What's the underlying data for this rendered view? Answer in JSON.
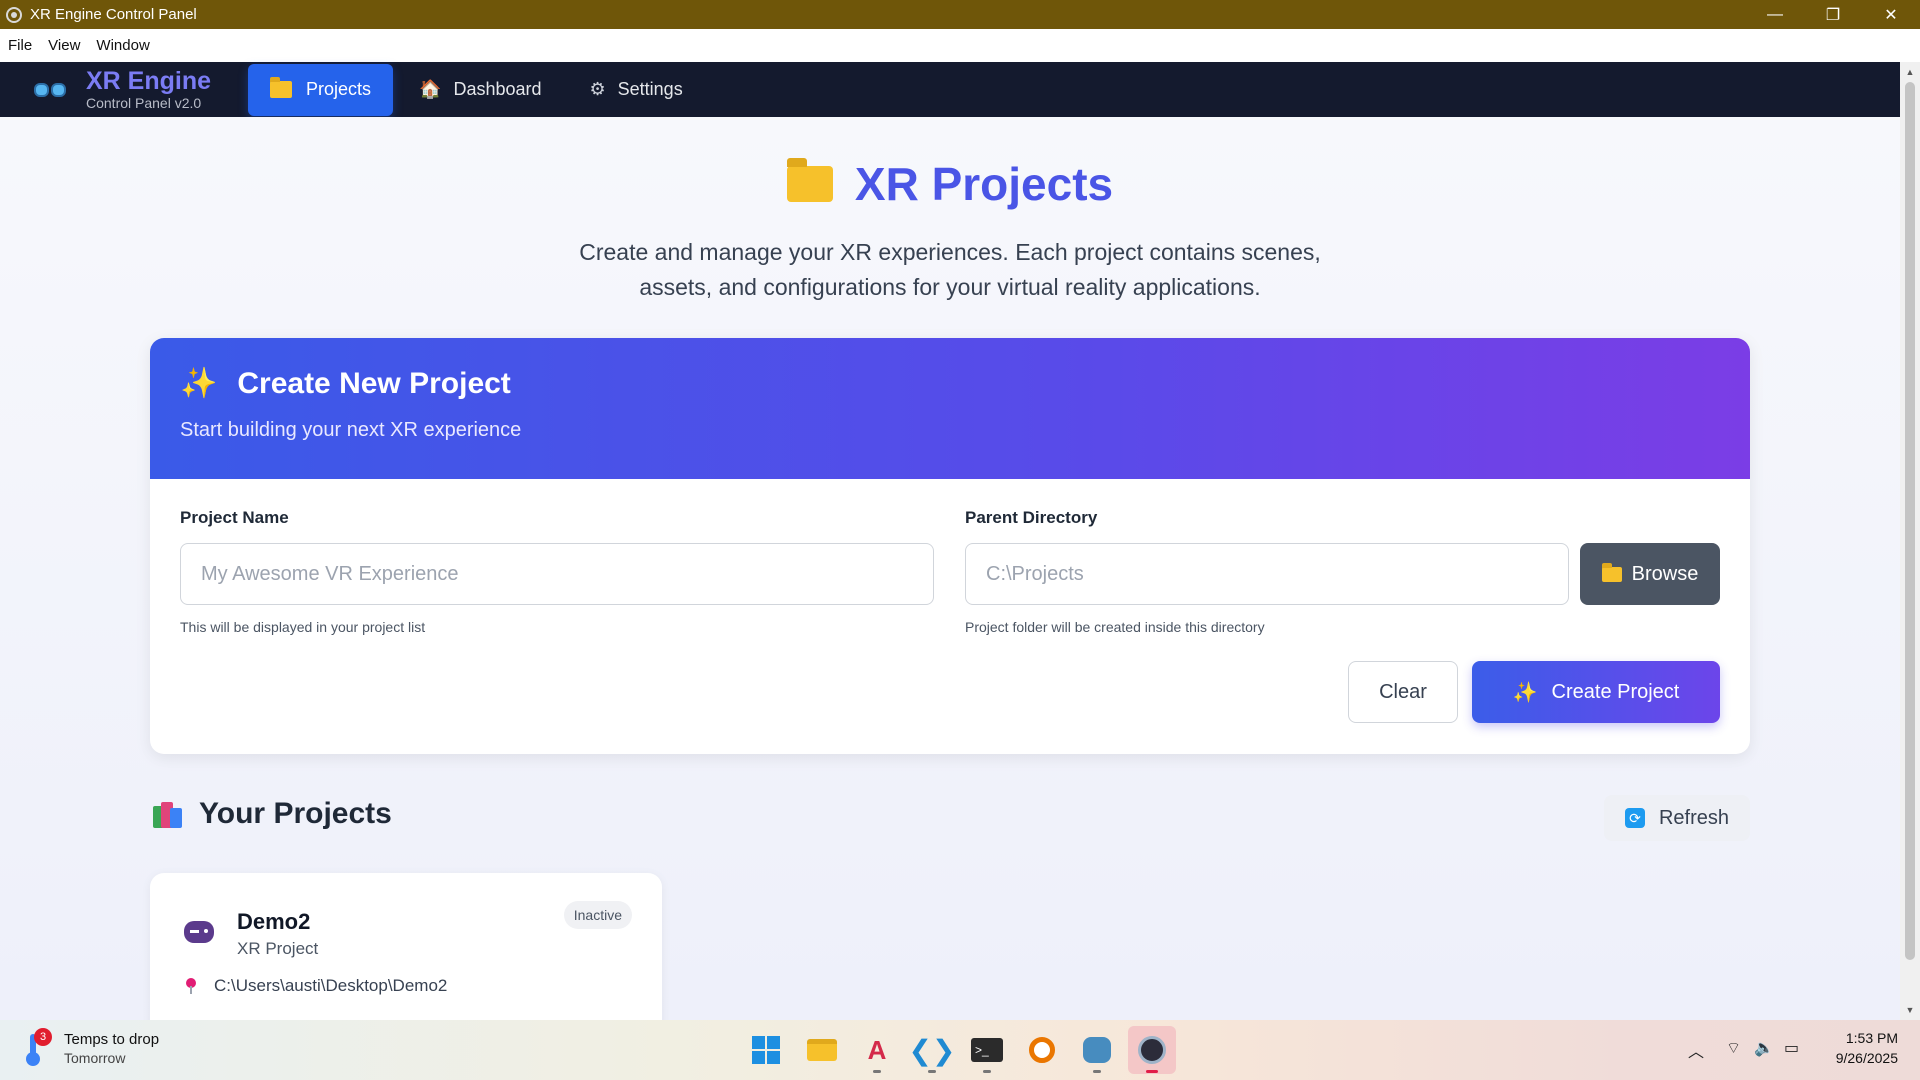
{
  "window": {
    "title": "XR Engine Control Panel",
    "minimize": "—",
    "restore": "❐",
    "close": "✕"
  },
  "menu": [
    "File",
    "View",
    "Window"
  ],
  "brand": {
    "name": "XR Engine",
    "subtitle": "Control Panel v2.0"
  },
  "nav": {
    "projects": "Projects",
    "dashboard": "Dashboard",
    "settings": "Settings"
  },
  "hero": {
    "title": "XR Projects",
    "description": "Create and manage your XR experiences. Each project contains scenes, assets, and configurations for your virtual reality applications."
  },
  "create": {
    "title": "Create New Project",
    "subtitle": "Start building your next XR experience",
    "name_label": "Project Name",
    "name_placeholder": "My Awesome VR Experience",
    "name_hint": "This will be displayed in your project list",
    "dir_label": "Parent Directory",
    "dir_placeholder": "C:\\Projects",
    "dir_hint": "Project folder will be created inside this directory",
    "browse": "Browse",
    "clear": "Clear",
    "create": "Create Project"
  },
  "projects": {
    "title": "Your Projects",
    "refresh": "Refresh",
    "items": [
      {
        "name": "Demo2",
        "type": "XR Project",
        "status": "Inactive",
        "path": "C:\\Users\\austi\\Desktop\\Demo2"
      }
    ]
  },
  "taskbar": {
    "weather_title": "Temps to drop",
    "weather_sub": "Tomorrow",
    "weather_badge": "3",
    "time": "1:53 PM",
    "date": "9/26/2025",
    "apps": [
      "start-icon",
      "file-explorer-icon",
      "app-icon",
      "vscode-icon",
      "terminal-icon",
      "blender-icon",
      "godot-icon",
      "xr-engine-icon"
    ]
  },
  "colors": {
    "accent": "#2563eb",
    "nav_bg": "#141a2e",
    "titlebar": "#6f5609",
    "hero_title": "#4a55e6"
  }
}
